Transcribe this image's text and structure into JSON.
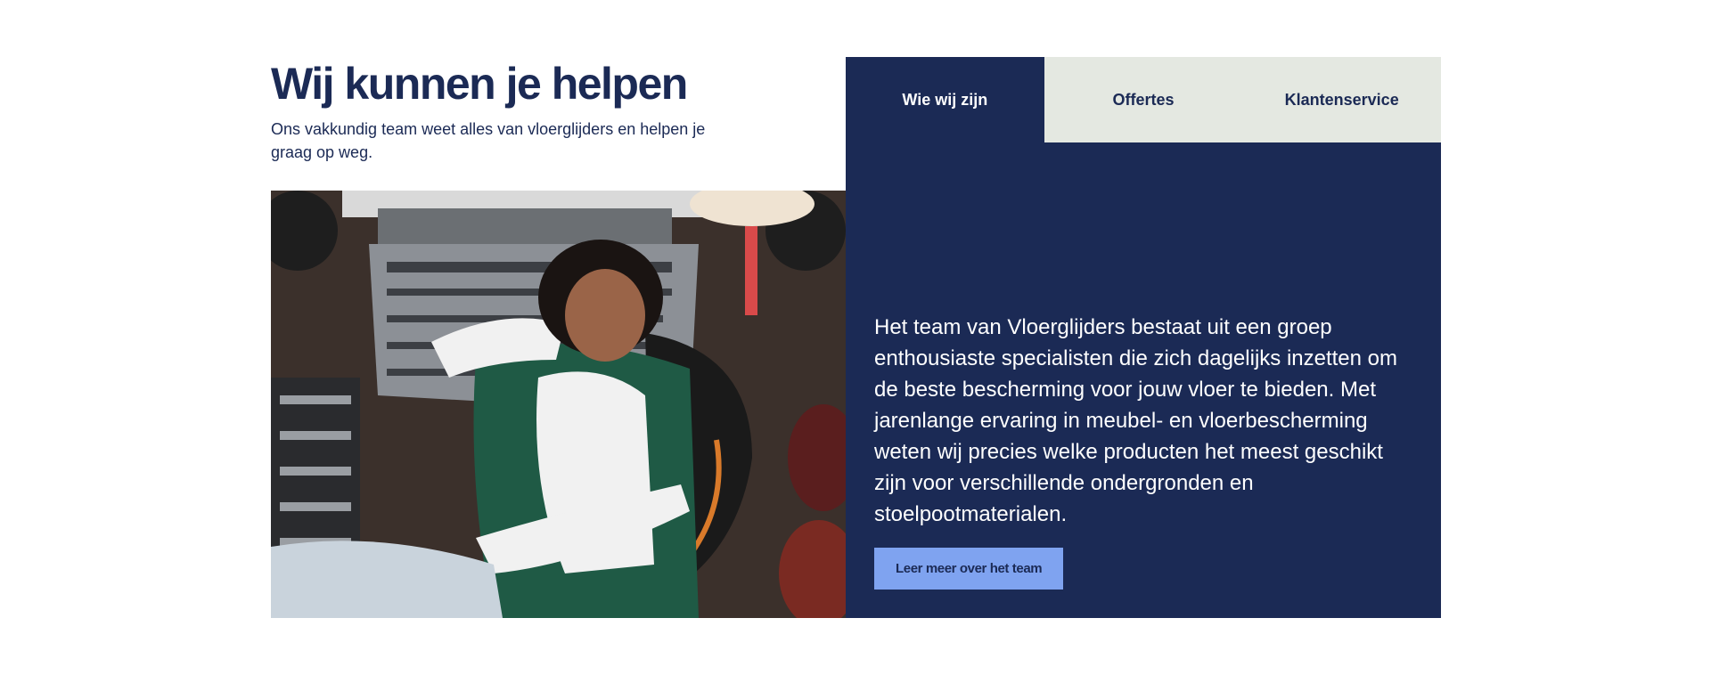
{
  "intro": {
    "title": "Wij kunnen je helpen",
    "subtitle": "Ons vakkundig team weet alles van vloerglijders en helpen je graag op weg."
  },
  "image": {
    "description_icon": "photo-team-member"
  },
  "tabs": [
    {
      "label": "Wie wij zijn",
      "active": true
    },
    {
      "label": "Offertes",
      "active": false
    },
    {
      "label": "Klantenservice",
      "active": false
    }
  ],
  "panel": {
    "text": "Het team van Vloerglijders bestaat uit een groep enthousiaste specialisten die zich dagelijks inzetten om de beste bescherming voor jouw vloer te bieden. Met jarenlange ervaring in meubel- en vloerbescherming weten wij precies welke producten het meest geschikt zijn voor verschillende ondergronden en stoelpootmaterialen.",
    "cta_label": "Leer meer over het team"
  },
  "colors": {
    "navy": "#1b2a55",
    "tab_inactive": "#e4e8e1",
    "cta": "#7fa3f0"
  }
}
